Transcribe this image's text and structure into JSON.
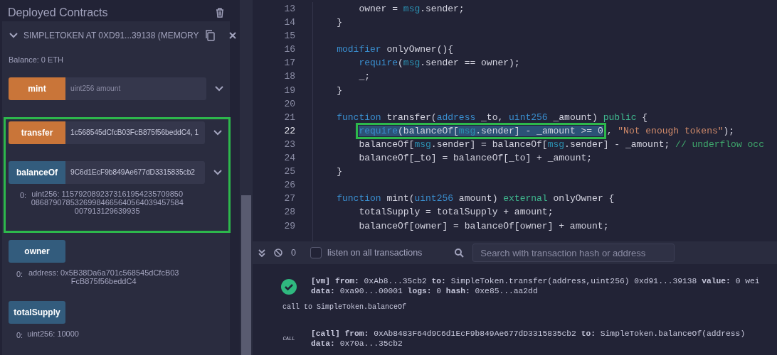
{
  "left_panel": {
    "title": "Deployed Contracts",
    "contract": {
      "title": "SIMPLETOKEN AT 0XD91...39138 (MEMORY",
      "expanded": true,
      "balance": "Balance: 0 ETH",
      "functions": [
        {
          "name": "mint",
          "kind": "transact",
          "placeholder": "uint256 amount"
        },
        {
          "name": "transfer",
          "kind": "transact",
          "value": "1c568545dCfcB03FcB875f56beddC4, 1",
          "highlighted": true
        },
        {
          "name": "balanceOf",
          "kind": "call",
          "value": "9C6d1EcF9b849Ae677dD3315835cb2",
          "highlighted": true,
          "outputs": [
            {
              "index": "0:",
              "value": "uint256: 115792089237316195423570985008687907853269984665640564039457584007913129639935"
            }
          ]
        },
        {
          "name": "owner",
          "kind": "call",
          "outputs": [
            {
              "index": "0:",
              "value": "address: 0x5B38Da6a701c568545dCfcB03FcB875f56beddC4"
            }
          ]
        },
        {
          "name": "totalSupply",
          "kind": "call",
          "outputs": [
            {
              "index": "0:",
              "value": "uint256: 10000"
            }
          ]
        }
      ]
    }
  },
  "editor": {
    "lines": [
      {
        "number": "13",
        "current": false,
        "segments": [
          {
            "text": "        owner = ",
            "kind": "plain"
          },
          {
            "text": "msg",
            "kind": "builtin"
          },
          {
            "text": ".sender;",
            "kind": "plain"
          }
        ]
      },
      {
        "number": "14",
        "current": false,
        "segments": [
          {
            "text": "    }",
            "kind": "plain"
          }
        ]
      },
      {
        "number": "15",
        "current": false
      },
      {
        "number": "16",
        "current": false,
        "segments": [
          {
            "text": "    modifier",
            "kind": "keyword"
          },
          {
            "text": " onlyOwner(){",
            "kind": "plain"
          }
        ]
      },
      {
        "number": "17",
        "current": false,
        "segments": [
          {
            "text": "        require",
            "kind": "keyword"
          },
          {
            "text": "(",
            "kind": "plain"
          },
          {
            "text": "msg",
            "kind": "builtin"
          },
          {
            "text": ".sender == owner);",
            "kind": "plain"
          }
        ]
      },
      {
        "number": "18",
        "current": false,
        "segments": [
          {
            "text": "        _;",
            "kind": "plain"
          }
        ]
      },
      {
        "number": "19",
        "current": false,
        "segments": [
          {
            "text": "    }",
            "kind": "plain"
          }
        ]
      },
      {
        "number": "20",
        "current": false
      },
      {
        "number": "21",
        "current": false,
        "segments": [
          {
            "text": "    function",
            "kind": "keyword"
          },
          {
            "text": " transfer(",
            "kind": "plain"
          },
          {
            "text": "address",
            "kind": "keyword"
          },
          {
            "text": " _to, ",
            "kind": "plain"
          },
          {
            "text": "uint256",
            "kind": "keyword"
          },
          {
            "text": " _amount) ",
            "kind": "plain"
          },
          {
            "text": "public",
            "kind": "modifier"
          },
          {
            "text": " {",
            "kind": "plain"
          }
        ]
      },
      {
        "number": "22",
        "current": true,
        "outlined": true,
        "segments": [
          {
            "text": "        require",
            "kind": "keyword",
            "selected": true
          },
          {
            "text": "(balanceOf[",
            "kind": "plain",
            "selected": true
          },
          {
            "text": "msg",
            "kind": "builtin",
            "selected": true
          },
          {
            "text": ".sender] - _amount >= 0",
            "kind": "plain",
            "selected": true
          },
          {
            "text": ",",
            "kind": "plain",
            "selected": false
          },
          {
            "text": " \"Not enough tokens\"",
            "kind": "string",
            "selected": false
          },
          {
            "text": ");",
            "kind": "plain",
            "selected": false
          }
        ]
      },
      {
        "number": "23",
        "current": false,
        "segments": [
          {
            "text": "        balanceOf[",
            "kind": "plain"
          },
          {
            "text": "msg",
            "kind": "builtin"
          },
          {
            "text": ".sender] = balanceOf[",
            "kind": "plain"
          },
          {
            "text": "msg",
            "kind": "builtin"
          },
          {
            "text": ".sender] - _amount; ",
            "kind": "plain"
          },
          {
            "text": "// underflow occ",
            "kind": "comment"
          }
        ]
      },
      {
        "number": "24",
        "current": false,
        "segments": [
          {
            "text": "        balanceOf[_to] = balanceOf[_to] + _amount;",
            "kind": "plain"
          }
        ]
      },
      {
        "number": "25",
        "current": false,
        "segments": [
          {
            "text": "    }",
            "kind": "plain"
          }
        ]
      },
      {
        "number": "26",
        "current": false
      },
      {
        "number": "27",
        "current": false,
        "segments": [
          {
            "text": "    function",
            "kind": "keyword"
          },
          {
            "text": " mint(",
            "kind": "plain"
          },
          {
            "text": "uint256",
            "kind": "keyword"
          },
          {
            "text": " amount) ",
            "kind": "plain"
          },
          {
            "text": "external",
            "kind": "modifier"
          },
          {
            "text": " onlyOwner {",
            "kind": "plain"
          }
        ]
      },
      {
        "number": "28",
        "current": false,
        "segments": [
          {
            "text": "        totalSupply = totalSupply + amount;",
            "kind": "plain"
          }
        ]
      },
      {
        "number": "29",
        "current": false,
        "segments": [
          {
            "text": "        balanceOf[owner] = balanceOf[owner] + amount;",
            "kind": "plain"
          }
        ]
      }
    ]
  },
  "terminal": {
    "pending_count": "0",
    "listen_all": {
      "label": "listen on all transactions",
      "checked": false
    },
    "search": {
      "placeholder": "Search with transaction hash or address"
    },
    "logs": [
      {
        "kind": "success",
        "lines": [
          "**[vm]** **from:** 0xAb8...35cb2 **to:** SimpleToken.transfer(address,uint256) 0xd91...39138 **value:** 0 wei",
          "**data:** 0xa90...00001 **logs:** 0 **hash:** 0xe85...aa2dd"
        ]
      },
      {
        "kind": "note",
        "lines": [
          "call to SimpleToken.balanceOf"
        ]
      },
      {
        "kind": "call",
        "badge": "CALL",
        "lines": [
          "**[call]** **from:** 0xAb8483F64d9C6d1EcF9b849Ae677dD3315835cb2 **to:** SimpleToken.balanceOf(address)",
          "**data:** 0x70a...35cb2"
        ]
      }
    ]
  }
}
